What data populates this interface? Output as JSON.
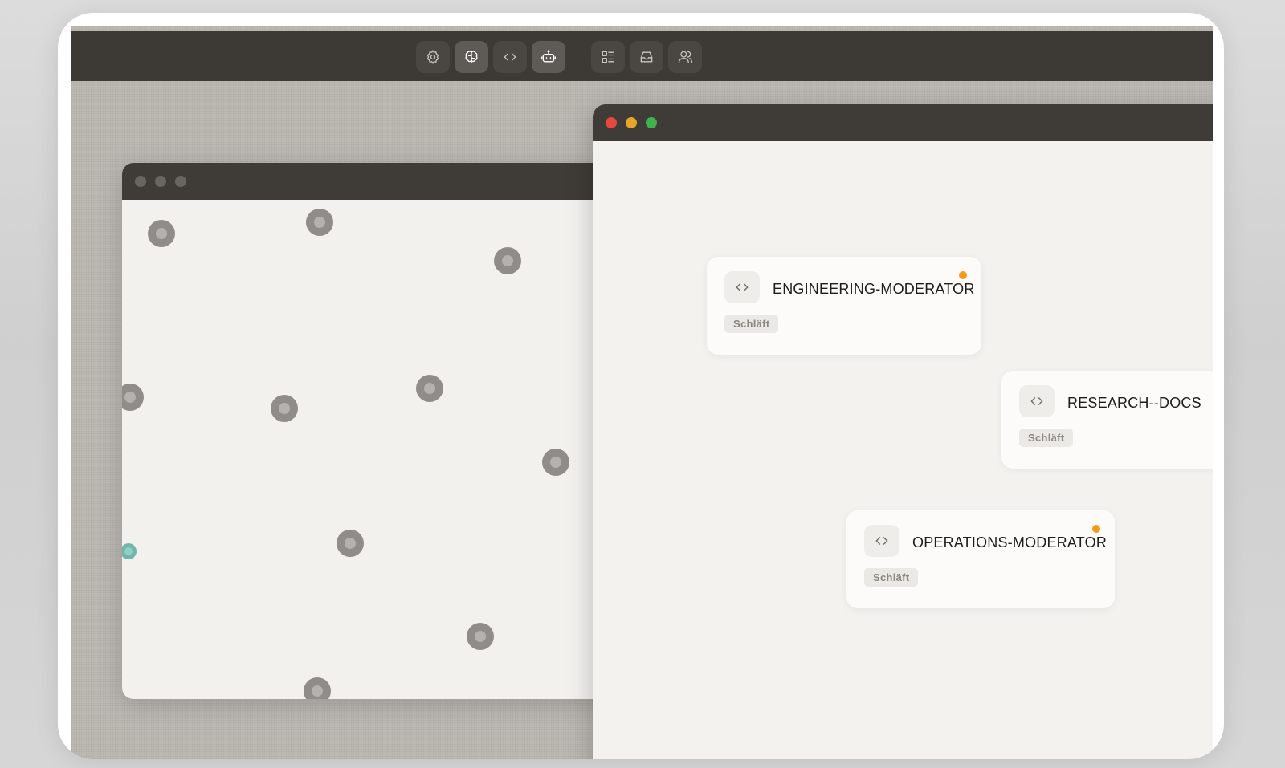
{
  "toolbar": {
    "buttons": [
      {
        "icon": "gear-icon",
        "active": false
      },
      {
        "icon": "brain-icon",
        "active": true
      },
      {
        "icon": "code-icon",
        "active": false
      },
      {
        "icon": "robot-icon",
        "active": true
      },
      {
        "icon": "grid-list-icon",
        "active": false
      },
      {
        "icon": "inbox-icon",
        "active": false
      },
      {
        "icon": "users-icon",
        "active": false
      }
    ]
  },
  "colors": {
    "close": "#e5483f",
    "minimize": "#e3a52a",
    "maximize": "#3fb24a",
    "status_dot": "#f29a1a",
    "node": "#8f8c89",
    "node_active": "#6fb7ad"
  },
  "agents": [
    {
      "title": "ENGINEERING-MODERATOR",
      "status": "Schläft",
      "icon": "code-icon",
      "indicator": true
    },
    {
      "title": "RESEARCH--DOCS",
      "status": "Schläft",
      "icon": "code-icon",
      "indicator": false
    },
    {
      "title": "OPERATIONS-MODERATOR",
      "status": "Schläft",
      "icon": "code-icon",
      "indicator": true
    }
  ]
}
